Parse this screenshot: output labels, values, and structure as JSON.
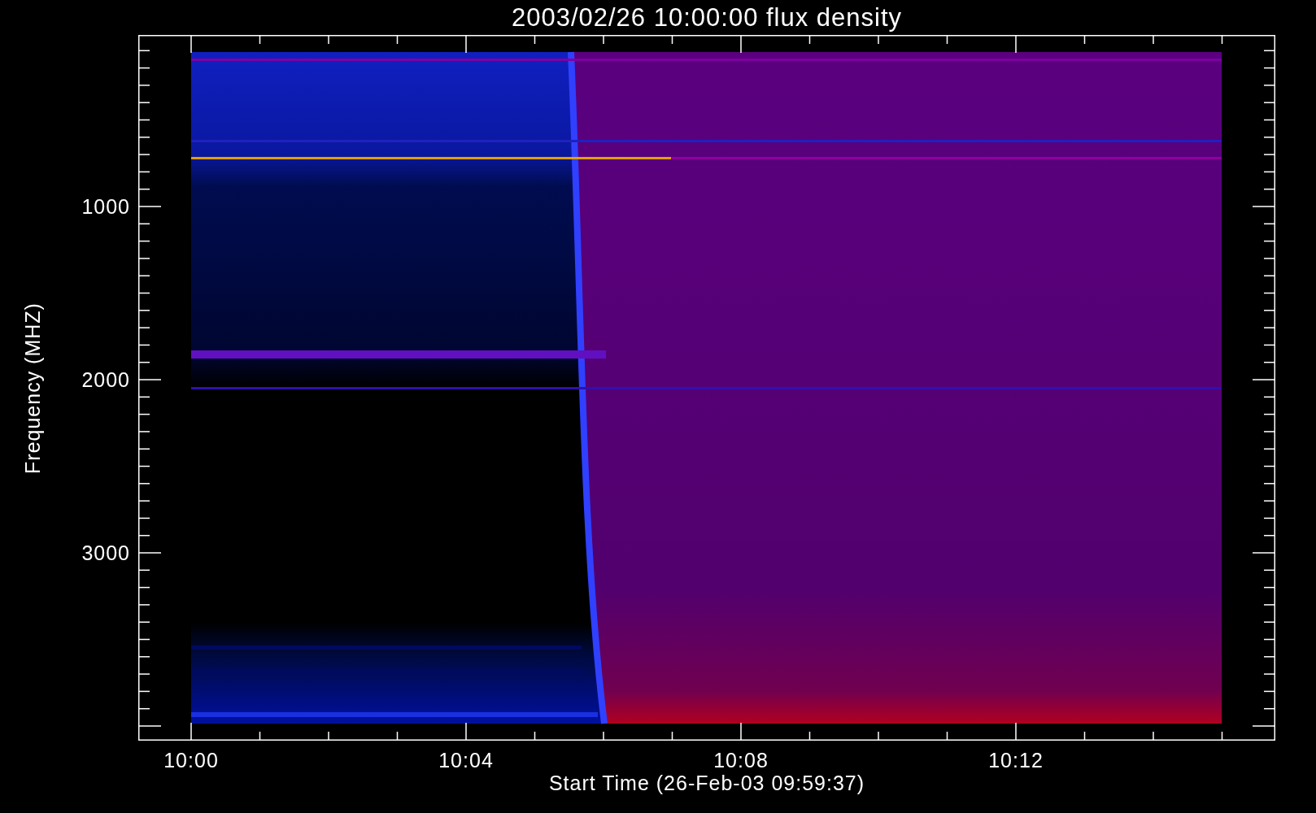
{
  "title": "2003/02/26 10:00:00 flux density",
  "ylabel": "Frequency (MHZ)",
  "yticks": [
    "1000",
    "2000",
    "3000"
  ],
  "xticks": [
    "10:00",
    "10:04",
    "10:08",
    "10:12"
  ],
  "xlabel": "Start Time (26-Feb-03 09:59:37)"
}
